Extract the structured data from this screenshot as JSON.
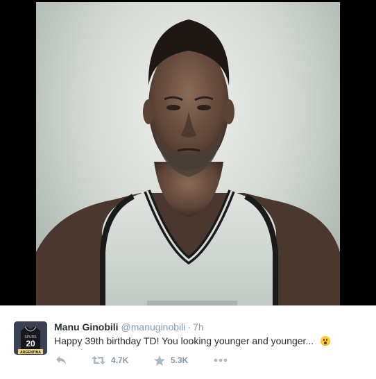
{
  "tweet": {
    "author_name": "Manu Ginobili",
    "author_handle": "@manuginobili",
    "separator": "·",
    "time": "7h",
    "text": "Happy 39th birthday TD! You looking younger and younger...",
    "emoji": "astonished-face",
    "retweet_count": "4.7K",
    "favorite_count": "5.3K"
  },
  "avatar": {
    "jersey_number": "20",
    "jersey_top_text": "SPURS",
    "caption": "ARGENTINA"
  },
  "icons": {
    "reply": "reply-icon",
    "retweet": "retweet-icon",
    "favorite": "star-icon",
    "more": "more-icon"
  },
  "colors": {
    "name": "#292f33",
    "meta": "#8899a6",
    "icon": "#aab8c2",
    "jersey_trim": "#1a1a1a"
  }
}
